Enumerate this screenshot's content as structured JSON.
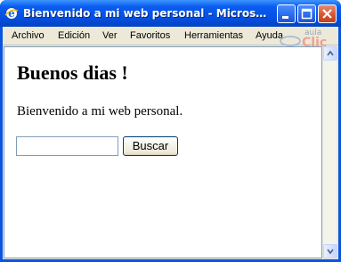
{
  "window": {
    "title": "Bienvenido a mi web personal - Microsoft Internet Explorer",
    "controls": {
      "minimize": "minimize",
      "maximize": "maximize",
      "close": "close"
    }
  },
  "menu": [
    "Archivo",
    "Edición",
    "Ver",
    "Favoritos",
    "Herramientas",
    "Ayuda"
  ],
  "logo": {
    "text_top": "aula",
    "text_bottom": "Clic"
  },
  "page": {
    "heading": "Buenos dias !",
    "paragraph": "Bienvenido a mi web personal.",
    "search": {
      "value": "",
      "button_label": "Buscar"
    }
  },
  "colors": {
    "title_bar": "#0a5cf0",
    "menu_bg": "#ece9d8",
    "close_button": "#d5532e"
  }
}
